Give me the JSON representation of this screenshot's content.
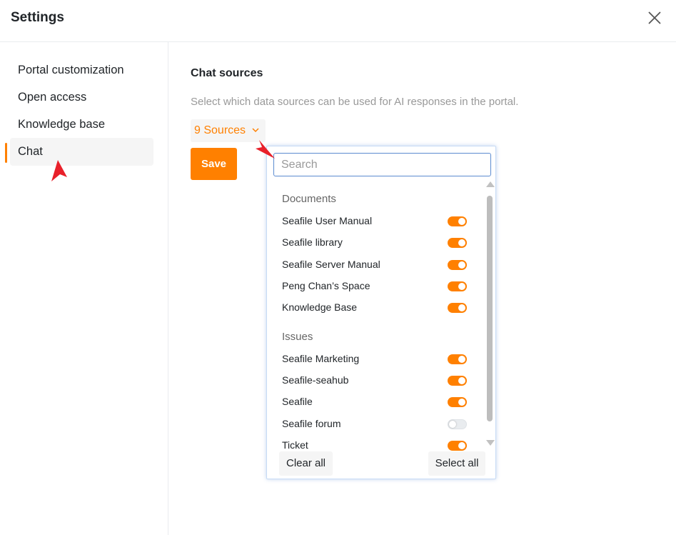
{
  "dialog": {
    "title": "Settings"
  },
  "sidebar": {
    "items": [
      {
        "label": "Portal customization"
      },
      {
        "label": "Open access"
      },
      {
        "label": "Knowledge base"
      },
      {
        "label": "Chat",
        "active": true
      }
    ]
  },
  "main": {
    "section_title": "Chat sources",
    "description": "Select which data sources can be used for AI responses in the portal.",
    "sources_button_label": "9 Sources",
    "save_label": "Save"
  },
  "dropdown": {
    "search_placeholder": "Search",
    "groups": [
      {
        "title": "Documents",
        "items": [
          {
            "label": "Seafile User Manual",
            "enabled": true
          },
          {
            "label": "Seafile library",
            "enabled": true
          },
          {
            "label": "Seafile Server Manual",
            "enabled": true
          },
          {
            "label": "Peng Chan’s Space",
            "enabled": true
          },
          {
            "label": "Knowledge Base",
            "enabled": true
          }
        ]
      },
      {
        "title": "Issues",
        "items": [
          {
            "label": "Seafile Marketing",
            "enabled": true
          },
          {
            "label": "Seafile-seahub",
            "enabled": true
          },
          {
            "label": "Seafile",
            "enabled": true
          },
          {
            "label": "Seafile forum",
            "enabled": false
          },
          {
            "label": "Ticket",
            "enabled": true
          }
        ]
      }
    ],
    "clear_all_label": "Clear all",
    "select_all_label": "Select all"
  },
  "colors": {
    "accent": "#ff8000",
    "annotation_arrow": "#e8202a"
  },
  "icons": {
    "close": "close-icon",
    "chevron": "chevron-down-icon"
  }
}
